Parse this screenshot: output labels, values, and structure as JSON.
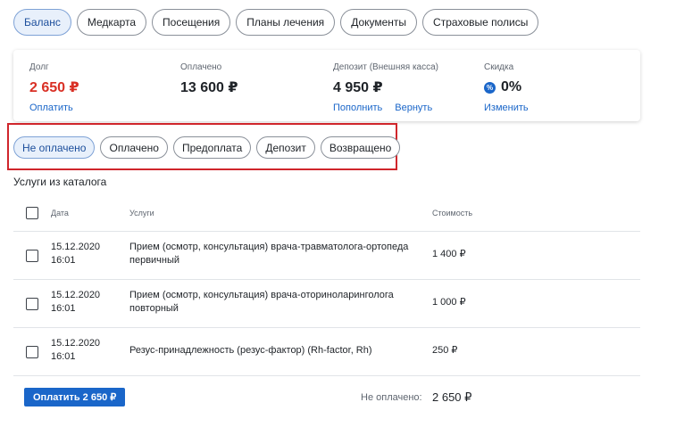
{
  "tabs": [
    {
      "label": "Баланс",
      "active": true
    },
    {
      "label": "Медкарта",
      "active": false
    },
    {
      "label": "Посещения",
      "active": false
    },
    {
      "label": "Планы лечения",
      "active": false
    },
    {
      "label": "Документы",
      "active": false
    },
    {
      "label": "Страховые полисы",
      "active": false
    }
  ],
  "balance": {
    "debt": {
      "label": "Долг",
      "value": "2 650 ₽",
      "action": "Оплатить"
    },
    "paid": {
      "label": "Оплачено",
      "value": "13 600 ₽"
    },
    "deposit": {
      "label": "Депозит (Внешняя касса)",
      "value": "4 950 ₽",
      "action_topup": "Пополнить",
      "action_return": "Вернуть"
    },
    "discount": {
      "label": "Скидка",
      "icon": "percent-icon",
      "icon_glyph": "%",
      "value": "0%",
      "action": "Изменить"
    }
  },
  "filters": [
    {
      "label": "Не оплачено",
      "active": true
    },
    {
      "label": "Оплачено",
      "active": false
    },
    {
      "label": "Предоплата",
      "active": false
    },
    {
      "label": "Депозит",
      "active": false
    },
    {
      "label": "Возвращено",
      "active": false
    }
  ],
  "section_title": "Услуги из каталога",
  "table": {
    "headers": {
      "date": "Дата",
      "service": "Услуги",
      "cost": "Стоимость"
    },
    "rows": [
      {
        "date": "15.12.2020",
        "time": "16:01",
        "service": "Прием (осмотр, консультация) врача-травматолога-ортопеда первичный",
        "cost": "1 400 ₽"
      },
      {
        "date": "15.12.2020",
        "time": "16:01",
        "service": "Прием (осмотр, консультация) врача-оториноларинголога повторный",
        "cost": "1 000 ₽"
      },
      {
        "date": "15.12.2020",
        "time": "16:01",
        "service": "Резус-принадлежность (резус-фактор) (Rh-factor, Rh)",
        "cost": "250 ₽"
      }
    ]
  },
  "footer": {
    "pay_button": "Оплатить 2 650 ₽",
    "unpaid_label": "Не оплачено:",
    "unpaid_value": "2 650 ₽"
  },
  "colors": {
    "accent": "#1a66c9",
    "debt": "#d93025",
    "highlight_box": "#d0262c"
  }
}
